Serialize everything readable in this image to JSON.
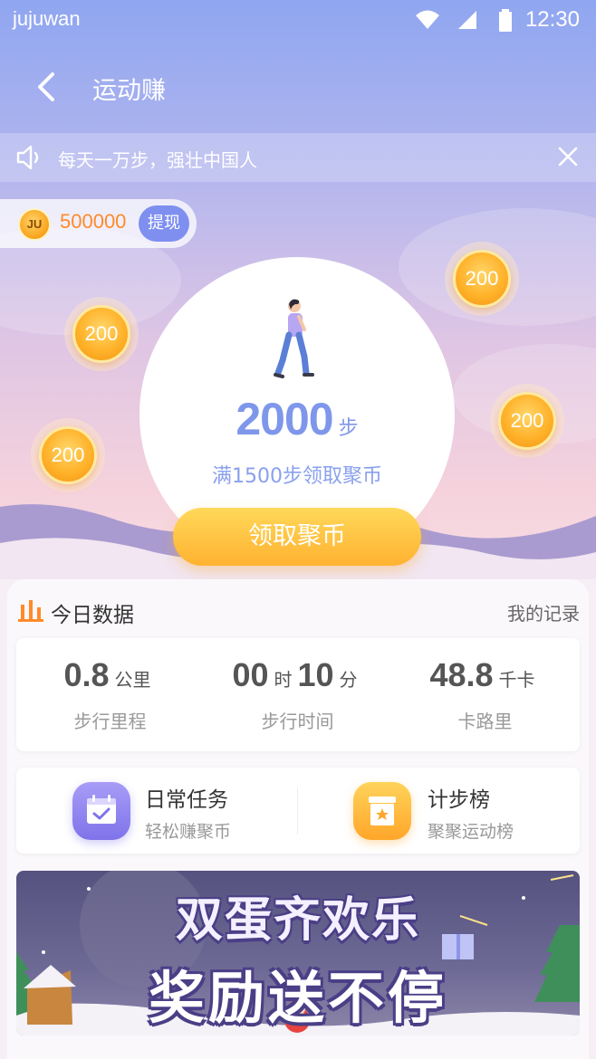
{
  "status_bar": {
    "carrier": "jujuwan",
    "time": "12:30"
  },
  "nav": {
    "title": "运动赚"
  },
  "notice": {
    "text": "每天一万步，强壮中国人"
  },
  "balance": {
    "icon_text": "JU",
    "amount": "500000",
    "withdraw_label": "提现"
  },
  "coins": [
    "200",
    "200",
    "200",
    "200"
  ],
  "steps": {
    "count": "2000",
    "unit": "步",
    "hint": "满1500步领取聚币"
  },
  "claim_button": "领取聚币",
  "today": {
    "title": "今日数据",
    "records_link": "我的记录",
    "stats": [
      {
        "value": "0.8",
        "unit": "公里",
        "label": "步行里程"
      },
      {
        "hours": "00",
        "hours_unit": "时",
        "minutes": "10",
        "minutes_unit": "分",
        "label": "步行时间"
      },
      {
        "value": "48.8",
        "unit": "千卡",
        "label": "卡路里"
      }
    ]
  },
  "tasks": [
    {
      "title": "日常任务",
      "subtitle": "轻松赚聚币",
      "icon": "calendar-check-icon"
    },
    {
      "title": "计步榜",
      "subtitle": "聚聚运动榜",
      "icon": "star-box-icon"
    }
  ],
  "banner": {
    "line1": "双蛋齐欢乐",
    "line2": "奖励送不停"
  },
  "colors": {
    "accent_blue": "#7f97ea",
    "coin_orange": "#ffb22a",
    "amount_orange": "#ff8a2a"
  }
}
